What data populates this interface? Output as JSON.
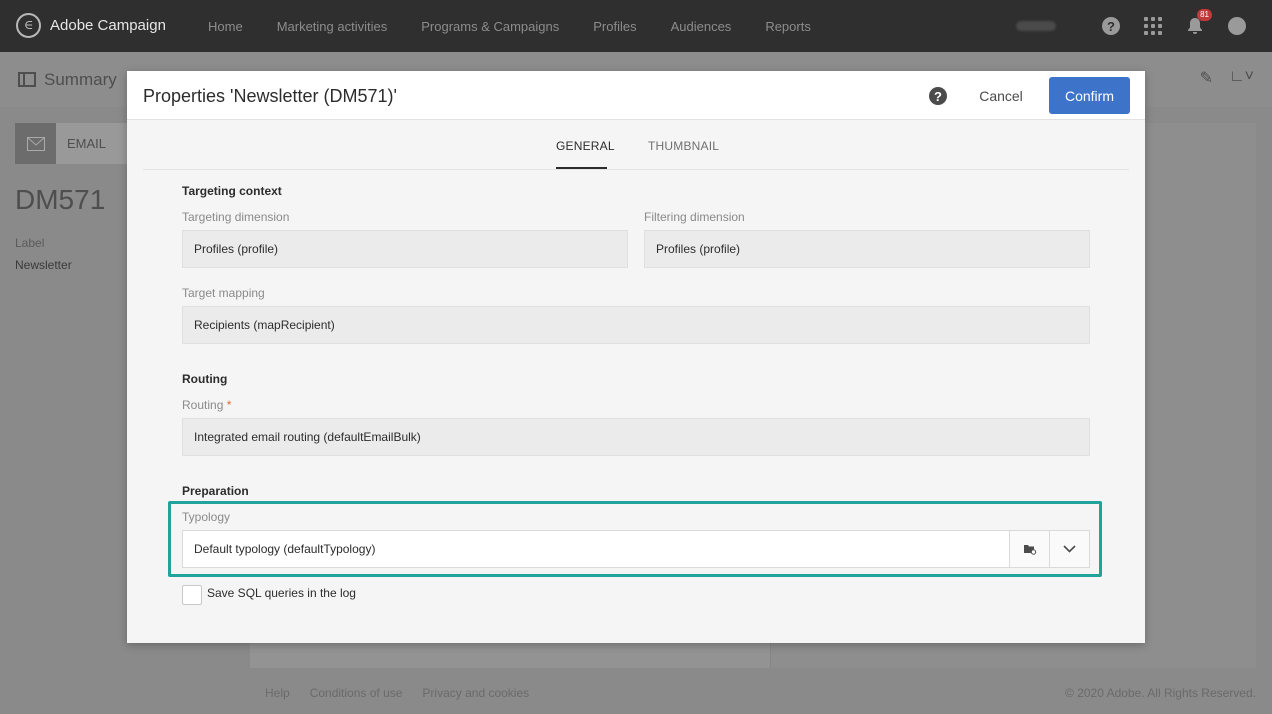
{
  "topbar": {
    "brand": "Adobe Campaign",
    "nav": [
      "Home",
      "Marketing activities",
      "Programs & Campaigns",
      "Profiles",
      "Audiences",
      "Reports"
    ],
    "notification_count": "81",
    "icons": [
      "help-icon",
      "apps-grid-icon",
      "bell-icon",
      "user-avatar-icon"
    ]
  },
  "background": {
    "summary_title": "Summary",
    "tile_label": "EMAIL",
    "delivery_code": "DM571",
    "label_caption": "Label",
    "label_value": "Newsletter",
    "footer_links": [
      "Help",
      "Conditions of use",
      "Privacy and cookies"
    ],
    "copyright": "© 2020 Adobe. All Rights Reserved."
  },
  "modal": {
    "title": "Properties 'Newsletter (DM571)'",
    "cancel_label": "Cancel",
    "confirm_label": "Confirm",
    "tabs": [
      "GENERAL",
      "THUMBNAIL"
    ],
    "active_tab": "GENERAL",
    "targeting": {
      "section_title": "Targeting context",
      "targeting_dimension_label": "Targeting dimension",
      "targeting_dimension_value": "Profiles (profile)",
      "filtering_dimension_label": "Filtering dimension",
      "filtering_dimension_value": "Profiles (profile)",
      "target_mapping_label": "Target mapping",
      "target_mapping_value": "Recipients (mapRecipient)"
    },
    "routing": {
      "section_title": "Routing",
      "routing_label": "Routing",
      "required_marker": "*",
      "routing_value": "Integrated email routing (defaultEmailBulk)"
    },
    "preparation": {
      "section_title": "Preparation",
      "typology_label": "Typology",
      "typology_value": "Default typology (defaultTypology)",
      "save_sql_label": "Save SQL queries in the log",
      "save_sql_checked": false
    }
  },
  "colors": {
    "confirm_button": "#3d73c9",
    "highlight_border": "#1fa39a",
    "required_marker": "#e06b35",
    "topbar": "#2f2f2f"
  }
}
